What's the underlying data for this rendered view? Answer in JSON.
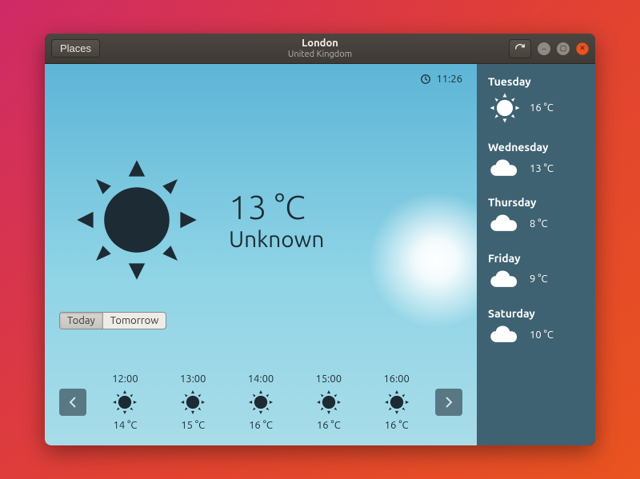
{
  "titlebar": {
    "places": "Places",
    "city": "London",
    "country": "United Kingdom"
  },
  "clock": {
    "time": "11:26"
  },
  "current": {
    "temp": "13 °C",
    "condition": "Unknown"
  },
  "toggle": {
    "today": "Today",
    "tomorrow": "Tomorrow"
  },
  "hourly": [
    {
      "time": "12:00",
      "temp": "14 °C",
      "icon": "sun"
    },
    {
      "time": "13:00",
      "temp": "15 °C",
      "icon": "sun"
    },
    {
      "time": "14:00",
      "temp": "16 °C",
      "icon": "sun"
    },
    {
      "time": "15:00",
      "temp": "16 °C",
      "icon": "sun"
    },
    {
      "time": "16:00",
      "temp": "16 °C",
      "icon": "sun"
    }
  ],
  "forecast": [
    {
      "day": "Tuesday",
      "temp": "16 °C",
      "icon": "sun"
    },
    {
      "day": "Wednesday",
      "temp": "13 °C",
      "icon": "cloud"
    },
    {
      "day": "Thursday",
      "temp": "8 °C",
      "icon": "cloud"
    },
    {
      "day": "Friday",
      "temp": "9 °C",
      "icon": "cloud"
    },
    {
      "day": "Saturday",
      "temp": "10 °C",
      "icon": "cloud"
    }
  ],
  "colors": {
    "dark": "#1d2b34",
    "sidebar": "#3e6272"
  }
}
